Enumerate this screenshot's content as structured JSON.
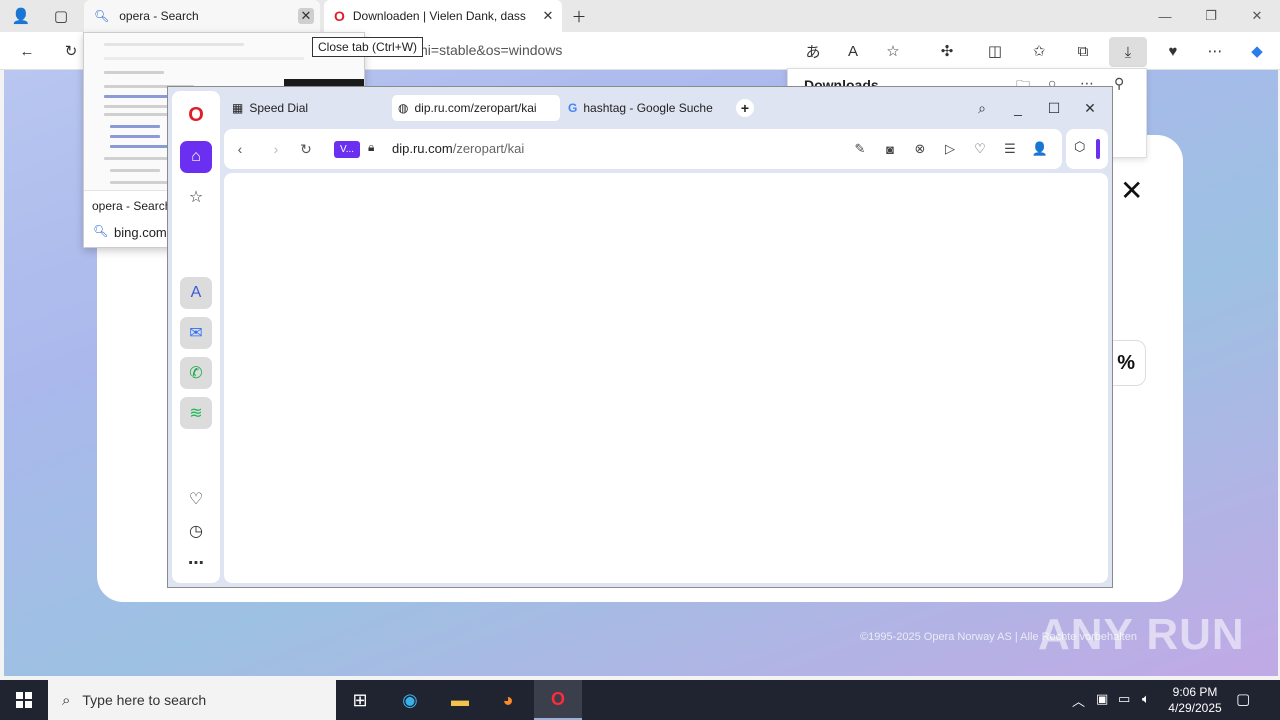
{
  "edge": {
    "tabs": [
      {
        "label": "opera - Search"
      },
      {
        "label": "Downloaden | Vielen Dank, dass"
      }
    ],
    "address_fragment": "ni=stable&os=windows",
    "close_tab_tooltip": "Close tab (Ctrl+W)",
    "downloads_title": "Downloads",
    "tab_preview": {
      "title": "opera - Search",
      "url": "bing.com"
    }
  },
  "page": {
    "percent_fragment": "%",
    "footer": "©1995-2025 Opera Norway AS | Alle Rechte vorbehalten"
  },
  "opera": {
    "tabs": [
      {
        "label": "Speed Dial"
      },
      {
        "label": "dip.ru.com/zeropart/kai"
      },
      {
        "label": "hashtag - Google Suche"
      }
    ],
    "vpn_label": "V...",
    "url_host": "dip.ru.com",
    "url_path": "/zeropart/kai"
  },
  "taskbar": {
    "search_placeholder": "Type here to search",
    "time": "9:06 PM",
    "date": "4/29/2025"
  },
  "watermark": "ANY RUN",
  "colors": {
    "opera_accent": "#6a2ff0",
    "opera_red": "#e01e28",
    "taskbar_bg": "#1f2430"
  }
}
